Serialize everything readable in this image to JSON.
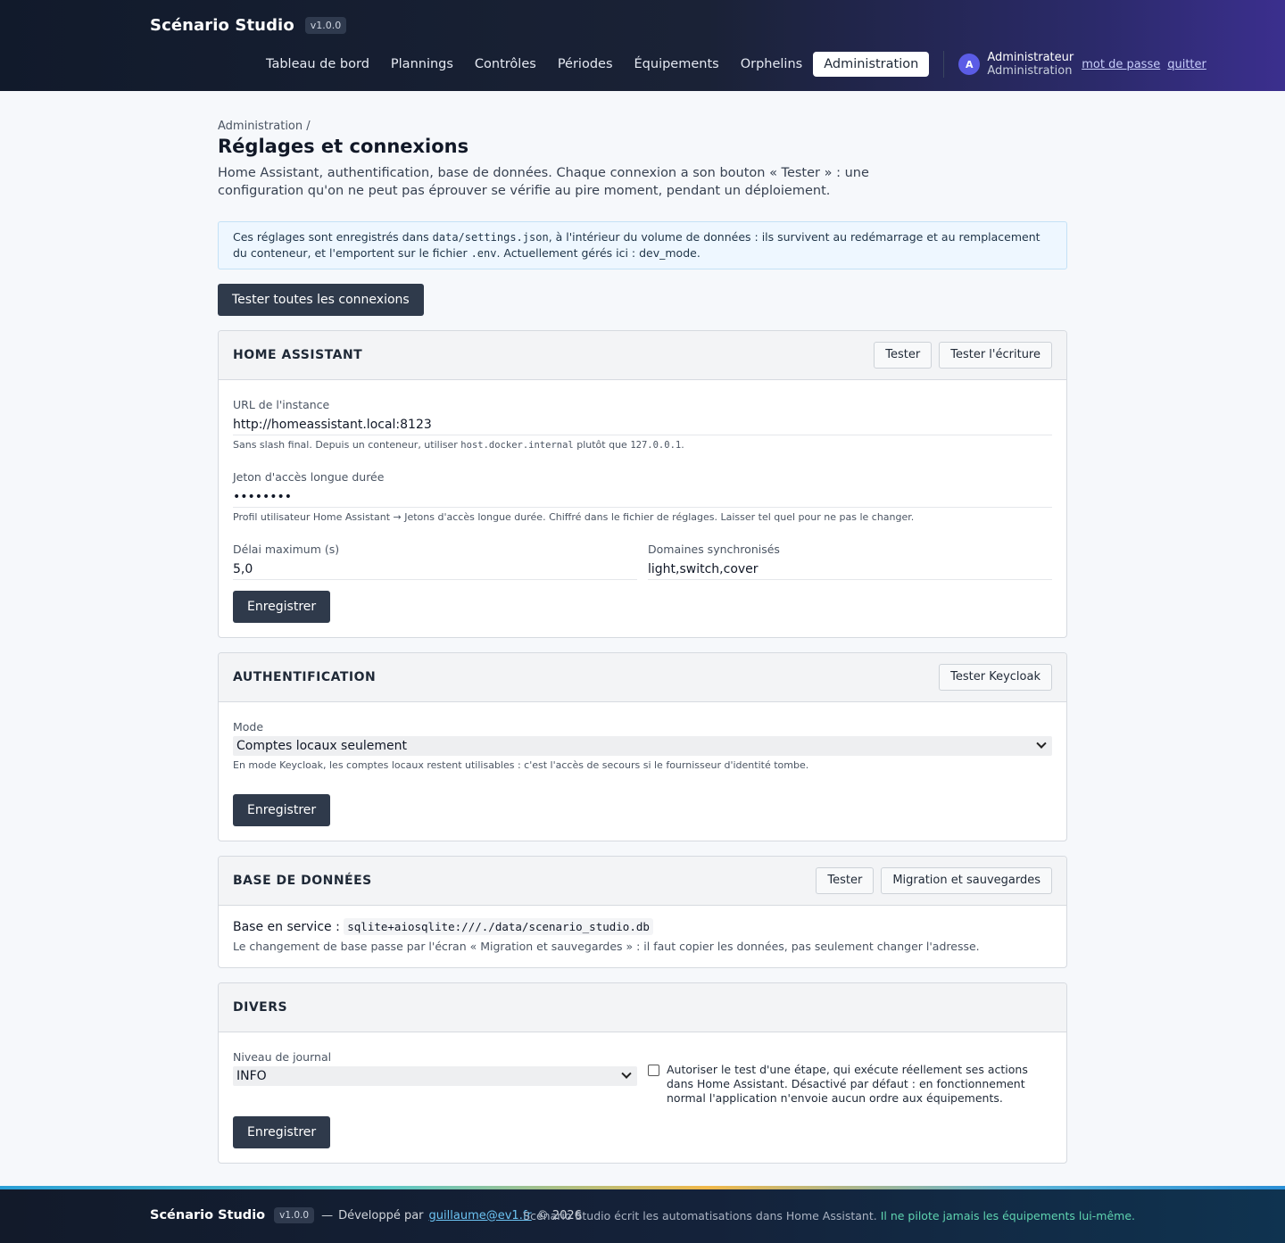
{
  "header": {
    "brand": "Scénario Studio",
    "version": "v1.0.0",
    "nav": [
      {
        "label": "Tableau de bord",
        "active": false
      },
      {
        "label": "Plannings",
        "active": false
      },
      {
        "label": "Contrôles",
        "active": false
      },
      {
        "label": "Périodes",
        "active": false
      },
      {
        "label": "Équipements",
        "active": false
      },
      {
        "label": "Orphelins",
        "active": false
      },
      {
        "label": "Administration",
        "active": true
      }
    ],
    "user": {
      "initial": "A",
      "name": "Administrateur",
      "role": "Administration",
      "password_link": "mot de passe",
      "logout_link": "quitter"
    }
  },
  "page": {
    "breadcrumb": "Administration /",
    "title": "Réglages et connexions",
    "description": "Home Assistant, authentification, base de données. Chaque connexion a son bouton « Tester » : une configuration qu'on ne peut pas éprouver se vérifie au pire moment, pendant un déploiement.",
    "info": {
      "text_1": "Ces réglages sont enregistrés dans ",
      "code_1": "data/settings.json",
      "text_2": ", à l'intérieur du volume de données : ils survivent au redémarrage et au remplacement du conteneur, et l'emportent sur le fichier ",
      "code_2": ".env",
      "text_3": ". Actuellement gérés ici : dev_mode."
    },
    "test_all_label": "Tester toutes les connexions"
  },
  "home_assistant": {
    "title": "HOME ASSISTANT",
    "test_label": "Tester",
    "test_write_label": "Tester l'écriture",
    "url_label": "URL de l'instance",
    "url_value": "http://homeassistant.local:8123",
    "url_help_1": "Sans slash final. Depuis un conteneur, utiliser ",
    "url_help_code_1": "host.docker.internal",
    "url_help_2": " plutôt que ",
    "url_help_code_2": "127.0.0.1",
    "url_help_3": ".",
    "token_label": "Jeton d'accès longue durée",
    "token_value": "••••••••",
    "token_help": "Profil utilisateur Home Assistant → Jetons d'accès longue durée. Chiffré dans le fichier de réglages. Laisser tel quel pour ne pas le changer.",
    "timeout_label": "Délai maximum (s)",
    "timeout_value": "5,0",
    "domains_label": "Domaines synchronisés",
    "domains_value": "light,switch,cover",
    "save_label": "Enregistrer"
  },
  "auth": {
    "title": "AUTHENTIFICATION",
    "test_label": "Tester Keycloak",
    "mode_label": "Mode",
    "mode_value": "Comptes locaux seulement",
    "mode_help": "En mode Keycloak, les comptes locaux restent utilisables : c'est l'accès de secours si le fournisseur d'identité tombe.",
    "save_label": "Enregistrer"
  },
  "database": {
    "title": "BASE DE DONNÉES",
    "test_label": "Tester",
    "migration_label": "Migration et sauvegardes",
    "current_label": "Base en service :",
    "current_value": "sqlite+aiosqlite:///./data/scenario_studio.db",
    "note": "Le changement de base passe par l'écran « Migration et sauvegardes » : il faut copier les données, pas seulement changer l'adresse."
  },
  "misc": {
    "title": "DIVERS",
    "log_label": "Niveau de journal",
    "log_value": "INFO",
    "step_test_label": "Autoriser le test d'une étape, qui exécute réellement ses actions dans Home Assistant. Désactivé par défaut : en fonctionnement normal l'application n'envoie aucun ordre aux équipements.",
    "step_test_checked": false,
    "save_label": "Enregistrer"
  },
  "footer": {
    "brand": "Scénario Studio",
    "version": "v1.0.0",
    "dash": "—",
    "developed_by": "Développé par",
    "email": "guillaume@ev1.fr",
    "copyright": "© 2026",
    "tagline_1": "Scénario Studio écrit les automatisations dans Home Assistant.",
    "tagline_2": "Il ne pilote jamais les équipements lui-même."
  },
  "colors": {
    "primary_button": "#2f3a4b",
    "info_background": "#eef7ff",
    "footer_accent": "#5fd4b0",
    "avatar": "#5b5ce6"
  }
}
